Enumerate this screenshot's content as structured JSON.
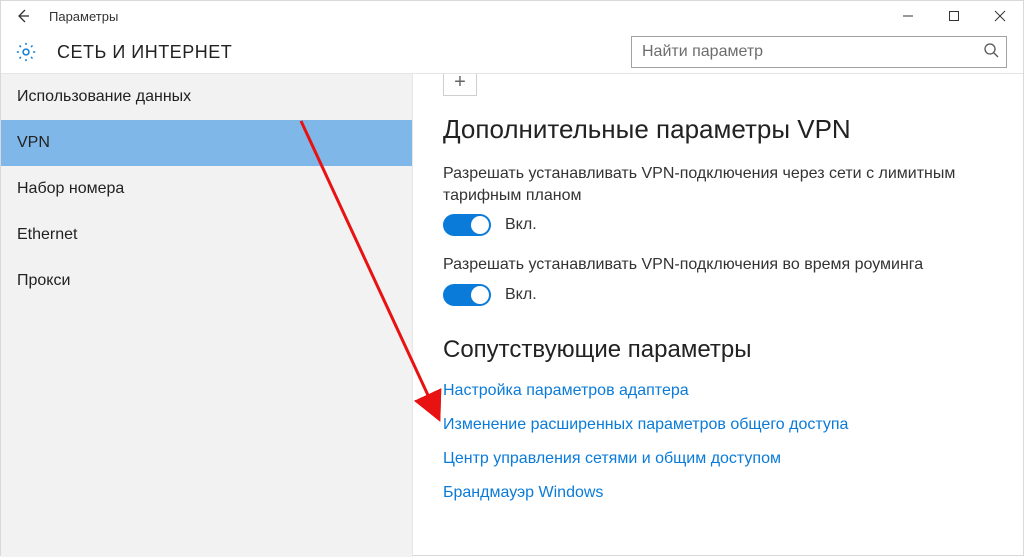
{
  "window": {
    "title": "Параметры"
  },
  "header": {
    "section_name": "СЕТЬ И ИНТЕРНЕТ",
    "search_placeholder": "Найти параметр"
  },
  "sidebar": {
    "items": [
      {
        "label": "Использование данных"
      },
      {
        "label": "VPN"
      },
      {
        "label": "Набор номера"
      },
      {
        "label": "Ethernet"
      },
      {
        "label": "Прокси"
      }
    ],
    "selected_index": 1
  },
  "main": {
    "advanced_heading": "Дополнительные параметры VPN",
    "options": [
      {
        "label": "Разрешать устанавливать VPN-подключения через сети с лимитным тарифным планом",
        "state_label": "Вкл.",
        "on": true
      },
      {
        "label": "Разрешать устанавливать VPN-подключения во время роуминга",
        "state_label": "Вкл.",
        "on": true
      }
    ],
    "related_heading": "Сопутствующие параметры",
    "links": [
      "Настройка параметров адаптера",
      "Изменение расширенных параметров общего доступа",
      "Центр управления сетями и общим доступом",
      "Брандмауэр Windows"
    ]
  }
}
